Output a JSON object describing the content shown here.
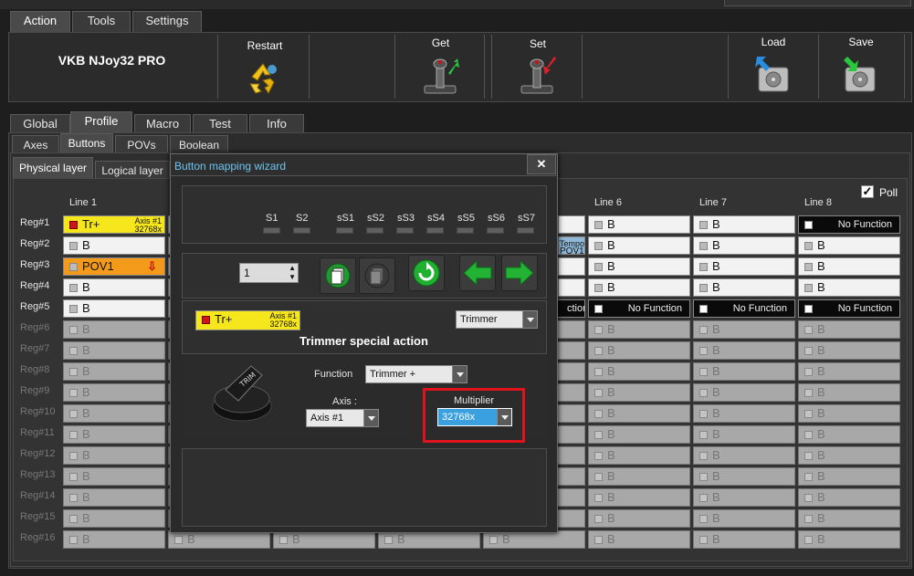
{
  "top_tabs": [
    "Action",
    "Tools",
    "Settings"
  ],
  "app_title": "VKB NJoy32 PRO",
  "ribbon": {
    "restart": "Restart",
    "get": "Get",
    "set": "Set",
    "load": "Load",
    "save": "Save"
  },
  "main_tabs": [
    "Global",
    "Profile",
    "Macro",
    "Test",
    "Info"
  ],
  "sub_tabs": [
    "Axes",
    "Buttons",
    "POVs",
    "Boolean"
  ],
  "layer_tabs": [
    "Physical layer",
    "Logical layer"
  ],
  "poll_label": "Poll",
  "line_headers": [
    "Line 1",
    "Line 6",
    "Line 7",
    "Line 8"
  ],
  "regs": [
    "Reg#1",
    "Reg#2",
    "Reg#3",
    "Reg#4",
    "Reg#5",
    "Reg#6",
    "Reg#7",
    "Reg#8",
    "Reg#9",
    "Reg#10",
    "Reg#11",
    "Reg#12",
    "Reg#13",
    "Reg#14",
    "Reg#15",
    "Reg#16"
  ],
  "cells": {
    "b": "B",
    "tr": "Tr+",
    "tr_cap1": "Axis #1",
    "tr_cap2": "32768x",
    "pov": "POV1",
    "no_function": "No Function",
    "partial_nofn": "ction",
    "tempo": "Tempo",
    "pov_small": "POV1"
  },
  "wizard": {
    "title": "Button mapping wizard",
    "close": "✕",
    "slots": [
      "S1",
      "S2",
      "sS1",
      "sS2",
      "sS3",
      "sS4",
      "sS5",
      "sS6",
      "sS7"
    ],
    "spin_value": "1",
    "btn_label": "Tr+",
    "btn_cap1": "Axis #1",
    "btn_cap2": "32768x",
    "type_value": "Trimmer",
    "section_title": "Trimmer special action",
    "function_label": "Function",
    "function_value": "Trimmer +",
    "axis_label": "Axis :",
    "axis_value": "Axis #1",
    "multiplier_label": "Multiplier",
    "multiplier_value": "32768x",
    "knob_text": "TRIM"
  }
}
